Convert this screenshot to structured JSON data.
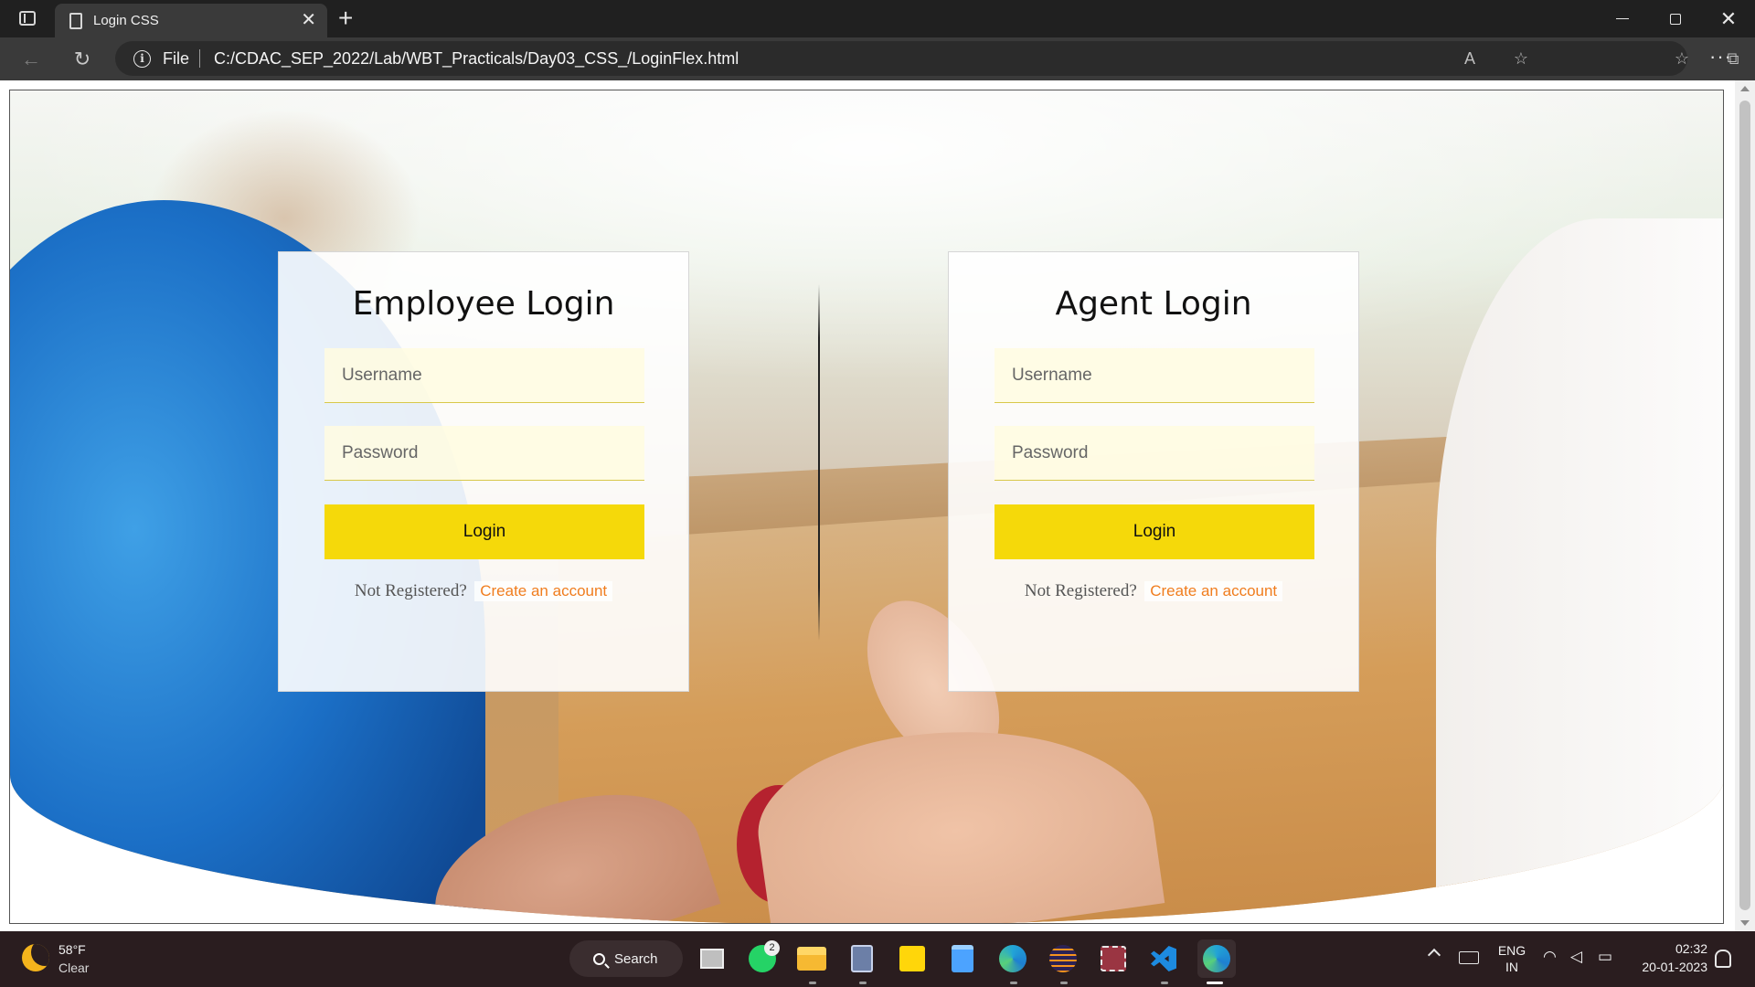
{
  "browser": {
    "tab_title": "Login CSS",
    "tab_close": "✕",
    "new_tab": "+",
    "file_label": "File",
    "url": "C:/CDAC_SEP_2022/Lab/WBT_Practicals/Day03_CSS_/LoginFlex.html",
    "more_label": "···"
  },
  "employee_card": {
    "title": "Employee Login",
    "username_placeholder": "Username",
    "password_placeholder": "Password",
    "login_label": "Login",
    "not_registered": "Not Registered?",
    "create_account": "Create an account"
  },
  "agent_card": {
    "title": "Agent Login",
    "username_placeholder": "Username",
    "password_placeholder": "Password",
    "login_label": "Login",
    "not_registered": "Not Registered?",
    "create_account": "Create an account"
  },
  "taskbar": {
    "weather_temp": "58°F",
    "weather_condition": "Clear",
    "search_label": "Search",
    "whatsapp_badge": "2",
    "language_line1": "ENG",
    "language_line2": "IN",
    "time": "02:32",
    "date": "20-01-2023"
  },
  "colors": {
    "accent_yellow": "#f5d90a",
    "link_orange": "#f07d1e",
    "browser_chrome": "#3a3a3a"
  }
}
